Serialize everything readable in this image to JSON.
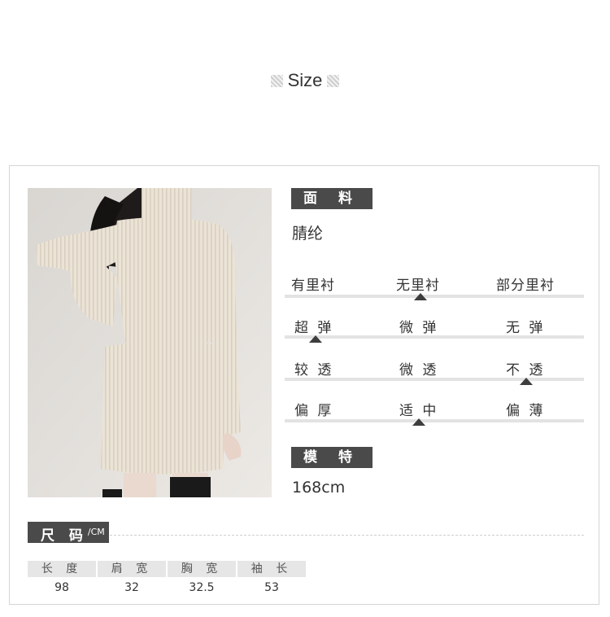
{
  "header": {
    "title": "Size"
  },
  "fabric": {
    "label": "面 料",
    "value": "腈纶"
  },
  "lining": {
    "options": [
      "有里衬",
      "无里衬",
      "部分里衬"
    ],
    "selected": "无里衬"
  },
  "elasticity": {
    "options": [
      "超 弹",
      "微 弹",
      "无 弹"
    ],
    "selected": "超 弹"
  },
  "transparency": {
    "options": [
      "较 透",
      "微 透",
      "不 透"
    ],
    "selected": "不 透"
  },
  "thickness": {
    "options": [
      "偏 厚",
      "适 中",
      "偏 薄"
    ],
    "selected": "适 中"
  },
  "model": {
    "label": "模 特",
    "height": "168cm"
  },
  "size_chart": {
    "label": "尺 码",
    "unit": "/CM",
    "headers": [
      "长 度",
      "肩 宽",
      "胸 宽",
      "袖 长"
    ],
    "values": [
      "98",
      "32",
      "32.5",
      "53"
    ]
  }
}
